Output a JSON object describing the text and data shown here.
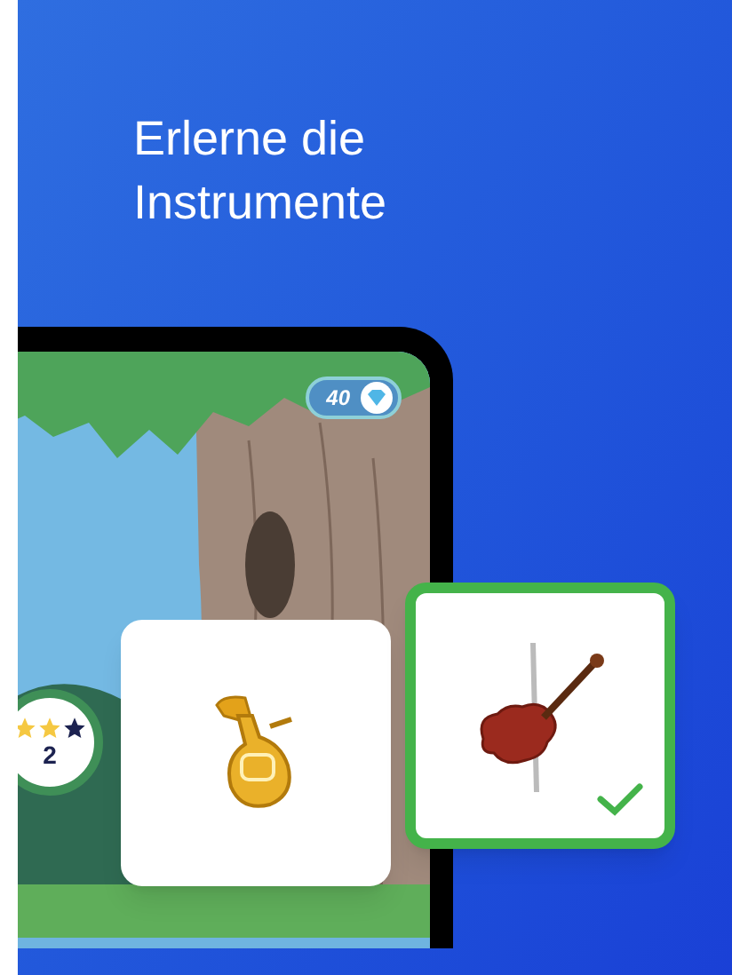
{
  "headline": "Erlerne die Instrumente",
  "game": {
    "gems": "40",
    "level_badge": {
      "level": "2",
      "stars": 2
    },
    "answer_cards": [
      {
        "kind": "tuba",
        "selected": false
      },
      {
        "kind": "violin",
        "selected": true
      }
    ]
  }
}
